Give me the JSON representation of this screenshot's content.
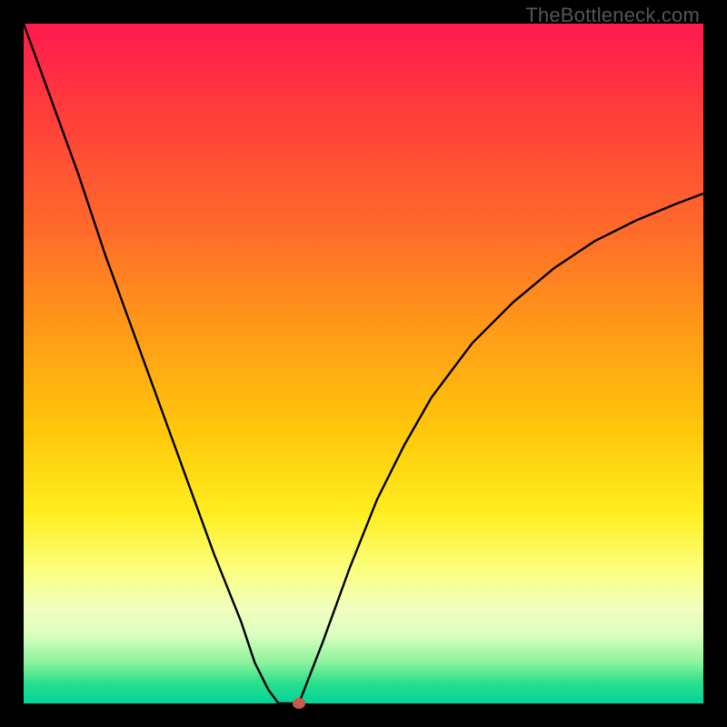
{
  "watermark": "TheBottleneck.com",
  "colors": {
    "frame": "#000000",
    "curve": "#000000",
    "marker": "#c9584e",
    "gradient_stops": [
      {
        "pos": 0.0,
        "color": "#ff1a4d"
      },
      {
        "pos": 0.12,
        "color": "#ff3a3c"
      },
      {
        "pos": 0.3,
        "color": "#ff6a2a"
      },
      {
        "pos": 0.45,
        "color": "#ff9a18"
      },
      {
        "pos": 0.6,
        "color": "#ffc80a"
      },
      {
        "pos": 0.72,
        "color": "#ffee20"
      },
      {
        "pos": 0.8,
        "color": "#fbff7a"
      },
      {
        "pos": 0.86,
        "color": "#f2ffbf"
      },
      {
        "pos": 0.9,
        "color": "#d8ffbf"
      },
      {
        "pos": 0.94,
        "color": "#8cf29d"
      },
      {
        "pos": 0.97,
        "color": "#2adf8c"
      },
      {
        "pos": 1.0,
        "color": "#00d49c"
      }
    ]
  },
  "chart_data": {
    "type": "line",
    "title": "",
    "xlabel": "",
    "ylabel": "",
    "xlim": [
      0,
      100
    ],
    "ylim": [
      0,
      100
    ],
    "grid": false,
    "series": [
      {
        "name": "left-branch",
        "x": [
          0,
          4,
          8,
          12,
          16,
          20,
          24,
          28,
          32,
          34,
          36,
          37.5
        ],
        "y": [
          100,
          89,
          78,
          66,
          55,
          44,
          33,
          22,
          12,
          6,
          2,
          0
        ]
      },
      {
        "name": "floor",
        "x": [
          37.5,
          40.5
        ],
        "y": [
          0,
          0
        ]
      },
      {
        "name": "right-branch",
        "x": [
          40.5,
          44,
          48,
          52,
          56,
          60,
          66,
          72,
          78,
          84,
          90,
          96,
          100
        ],
        "y": [
          0,
          9,
          20,
          30,
          38,
          45,
          53,
          59,
          64,
          68,
          71,
          73.5,
          75
        ]
      }
    ],
    "markers": [
      {
        "name": "vertex-dot",
        "x": 40.5,
        "y": 0
      }
    ]
  }
}
